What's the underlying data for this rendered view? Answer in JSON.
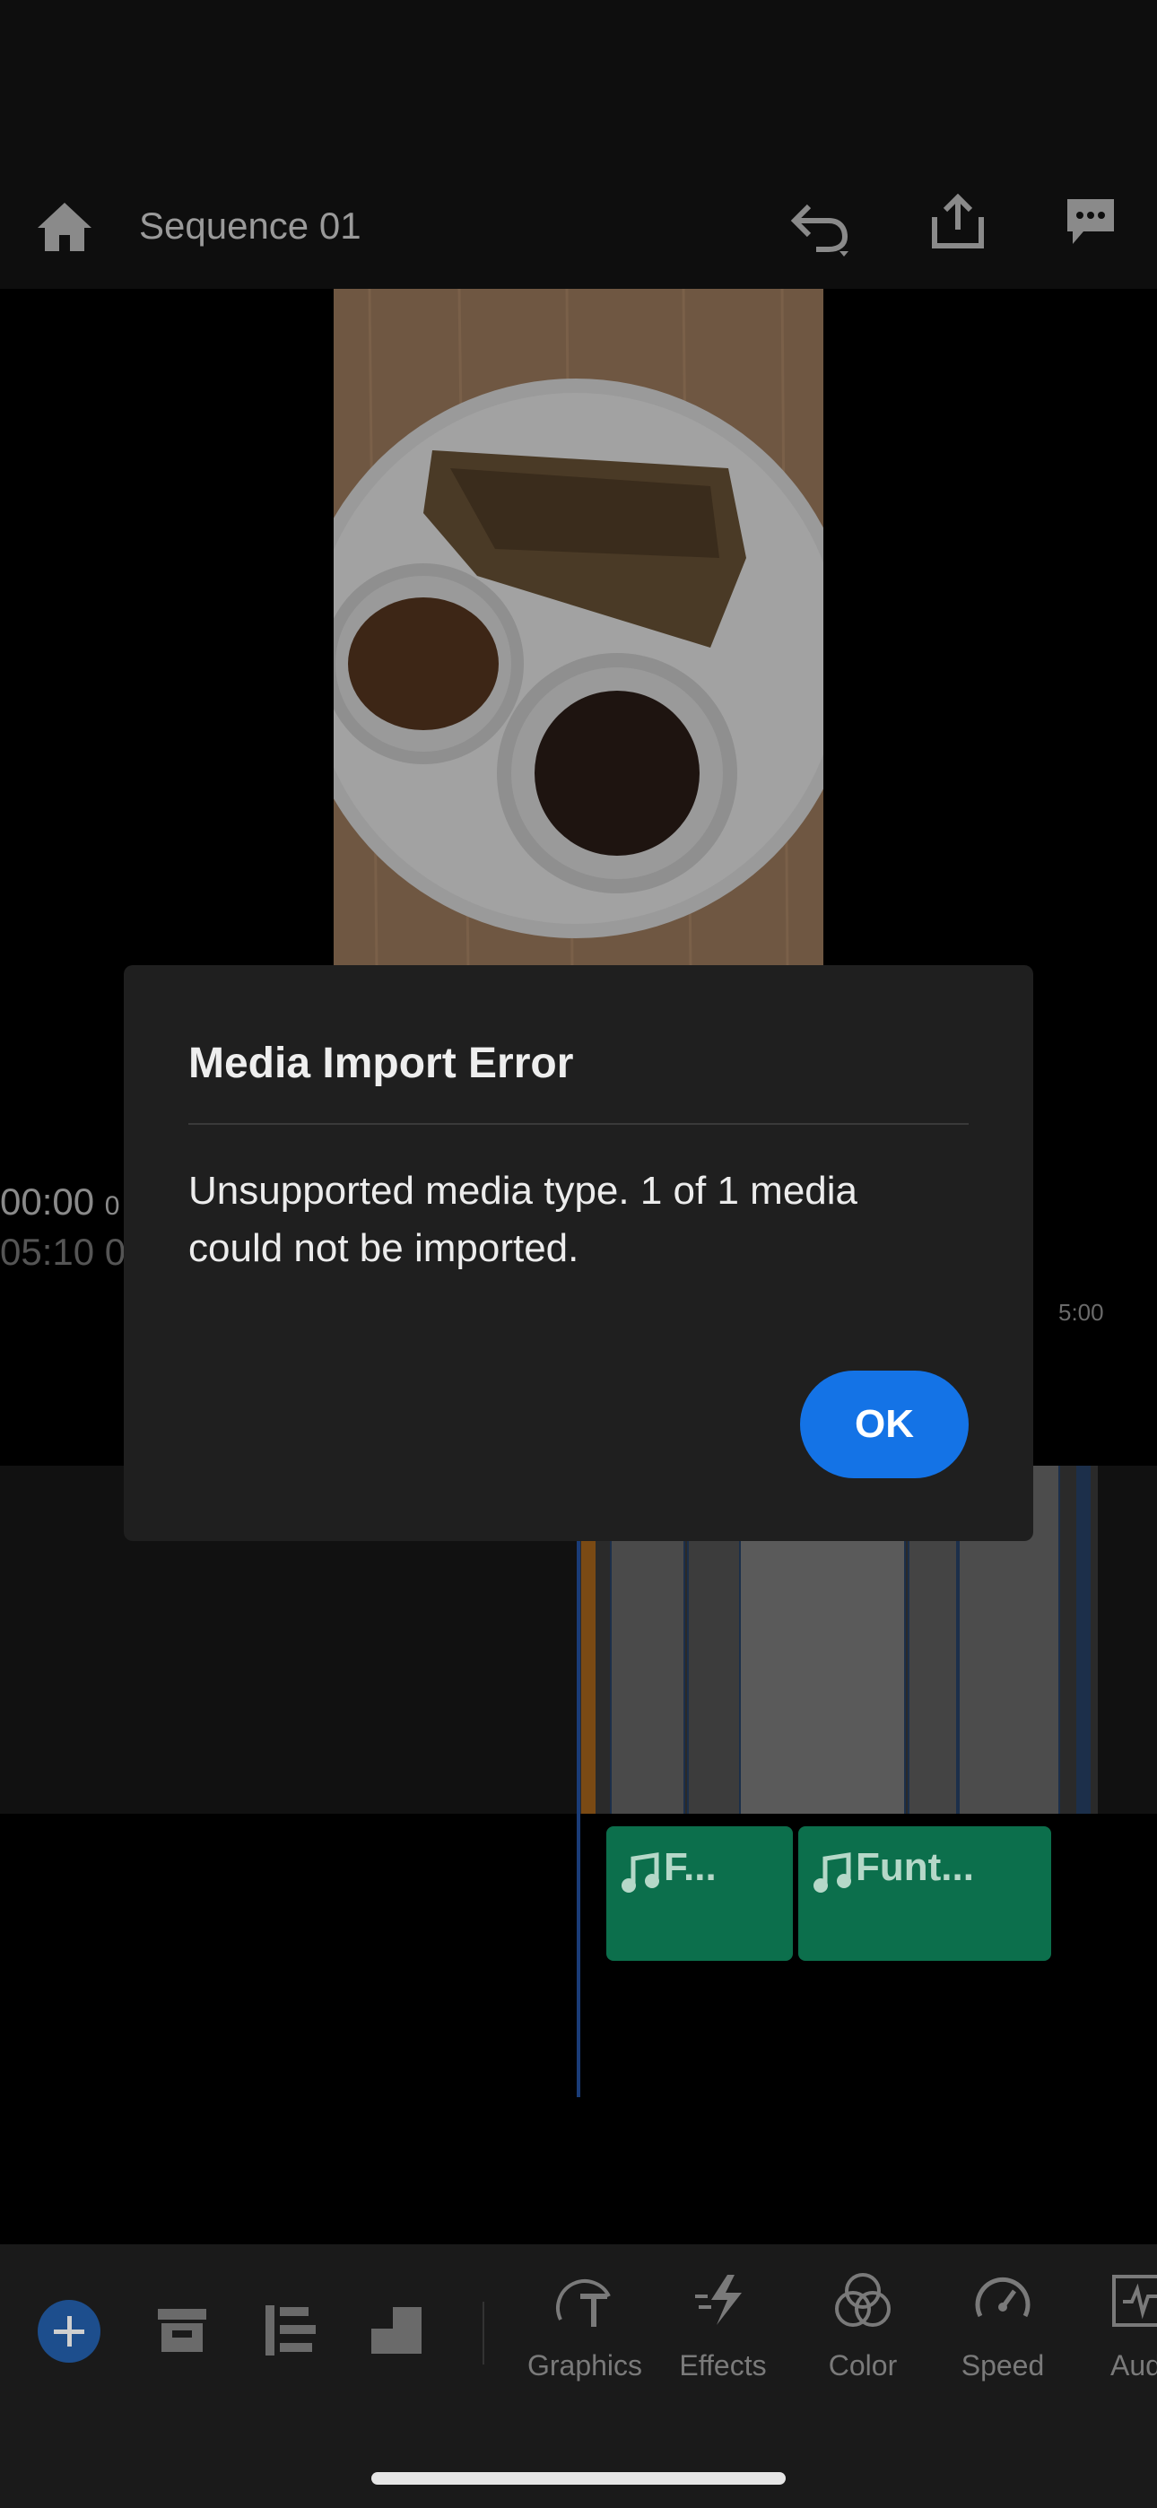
{
  "header": {
    "sequence_title": "Sequence 01"
  },
  "timecode": {
    "current": "00:00",
    "current_suffix": "0",
    "total": "05:10",
    "total_suffix": "0",
    "ruler_label": "5:00"
  },
  "timeline": {
    "audio_clips": [
      {
        "label": "F..."
      },
      {
        "label": "Funt..."
      }
    ]
  },
  "toolbar": {
    "tools": [
      {
        "label": "Graphics",
        "icon": "graphics-icon"
      },
      {
        "label": "Effects",
        "icon": "effects-icon"
      },
      {
        "label": "Color",
        "icon": "color-icon"
      },
      {
        "label": "Speed",
        "icon": "speed-icon"
      },
      {
        "label": "Aud",
        "icon": "audio-icon"
      }
    ]
  },
  "dialog": {
    "title": "Media Import Error",
    "message": "Unsupported media type. 1 of 1 media could not be imported.",
    "ok_label": "OK"
  },
  "colors": {
    "accent": "#1473e6",
    "audio_clip": "#0c6f4c",
    "dialog_bg": "#1f1f1f"
  }
}
